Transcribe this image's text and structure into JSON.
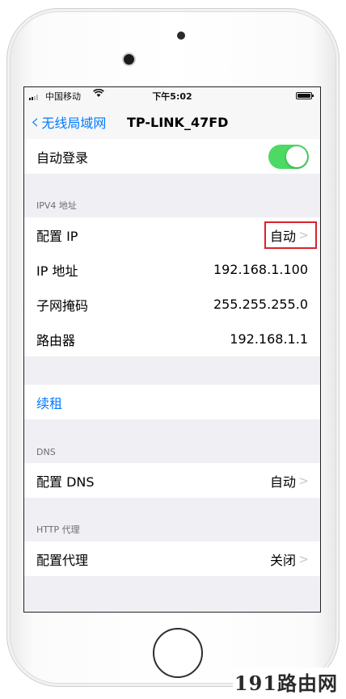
{
  "status_bar": {
    "carrier": "中国移动",
    "time": "下午5:02",
    "wifi_icon": "wifi-icon"
  },
  "nav": {
    "back_label": "无线局域网",
    "title": "TP-LINK_47FD"
  },
  "auto_login": {
    "label": "自动登录",
    "enabled": true
  },
  "ipv4": {
    "header": "IPV4 地址",
    "configure_ip": {
      "label": "配置 IP",
      "value": "自动"
    },
    "ip_address": {
      "label": "IP 地址",
      "value": "192.168.1.100"
    },
    "subnet_mask": {
      "label": "子网掩码",
      "value": "255.255.255.0"
    },
    "router": {
      "label": "路由器",
      "value": "192.168.1.1"
    }
  },
  "renew_lease": {
    "label": "续租"
  },
  "dns": {
    "header": "DNS",
    "configure_dns": {
      "label": "配置 DNS",
      "value": "自动"
    }
  },
  "proxy": {
    "header": "HTTP 代理",
    "configure_proxy": {
      "label": "配置代理",
      "value": "关闭"
    }
  },
  "chevron_glyph": ">",
  "watermark": "191路由网",
  "colors": {
    "accent": "#007aff",
    "toggle_on": "#4cd964",
    "highlight": "#d8232a"
  }
}
